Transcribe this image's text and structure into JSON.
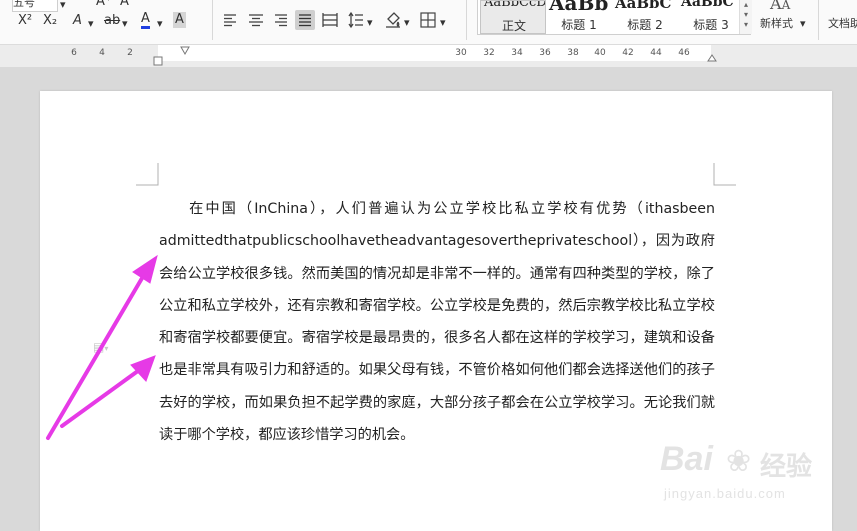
{
  "ribbon": {
    "font_size_value": "五号",
    "superscript_label": "X²",
    "subscript_label": "X₂",
    "clear_format_label": "A",
    "char_border_label": "ab",
    "font_color_label": "A",
    "char_shading_label": "A",
    "styles": [
      {
        "sample": "AaBbCcD",
        "name": "正文",
        "selected": true
      },
      {
        "sample": "AaBb",
        "name": "标题 1"
      },
      {
        "sample": "AaBbC",
        "name": "标题 2"
      },
      {
        "sample": "AaBbC",
        "name": "标题 3"
      }
    ],
    "new_style_label": "新样式",
    "right_label": "文档助"
  },
  "ruler": {
    "left_labels": [
      "6",
      "4",
      "2"
    ],
    "right_labels": [
      "30",
      "32",
      "34",
      "36",
      "38",
      "40",
      "42",
      "44",
      "46"
    ]
  },
  "document": {
    "paragraph": "在中国（InChina），人们普遍认为公立学校比私立学校有优势（ithasbeen admittedthatpublicschoolhavetheadvantagesovertheprivateschool），因为政府会给公立学校很多钱。然而美国的情况却是非常不一样的。通常有四种类型的学校，除了公立和私立学校外，还有宗教和寄宿学校。公立学校是免费的，然后宗教学校比私立学校和寄宿学校都要便宜。寄宿学校是最昂贵的，很多名人都在这样的学校学习，建筑和设备也是非常具有吸引力和舒适的。如果父母有钱，不管价格如何他们都会选择送他们的孩子去好的学校，而如果负担不起学费的家庭，大部分孩子都会在公立学校学习。无论我们就读于哪个学校，都应该珍惜学习的机会。"
  },
  "annotation": {
    "arrow_color": "#e63ae6"
  },
  "watermark": {
    "brand": "Bai",
    "brand2": "经验",
    "url": "jingyan.baidu.com"
  }
}
